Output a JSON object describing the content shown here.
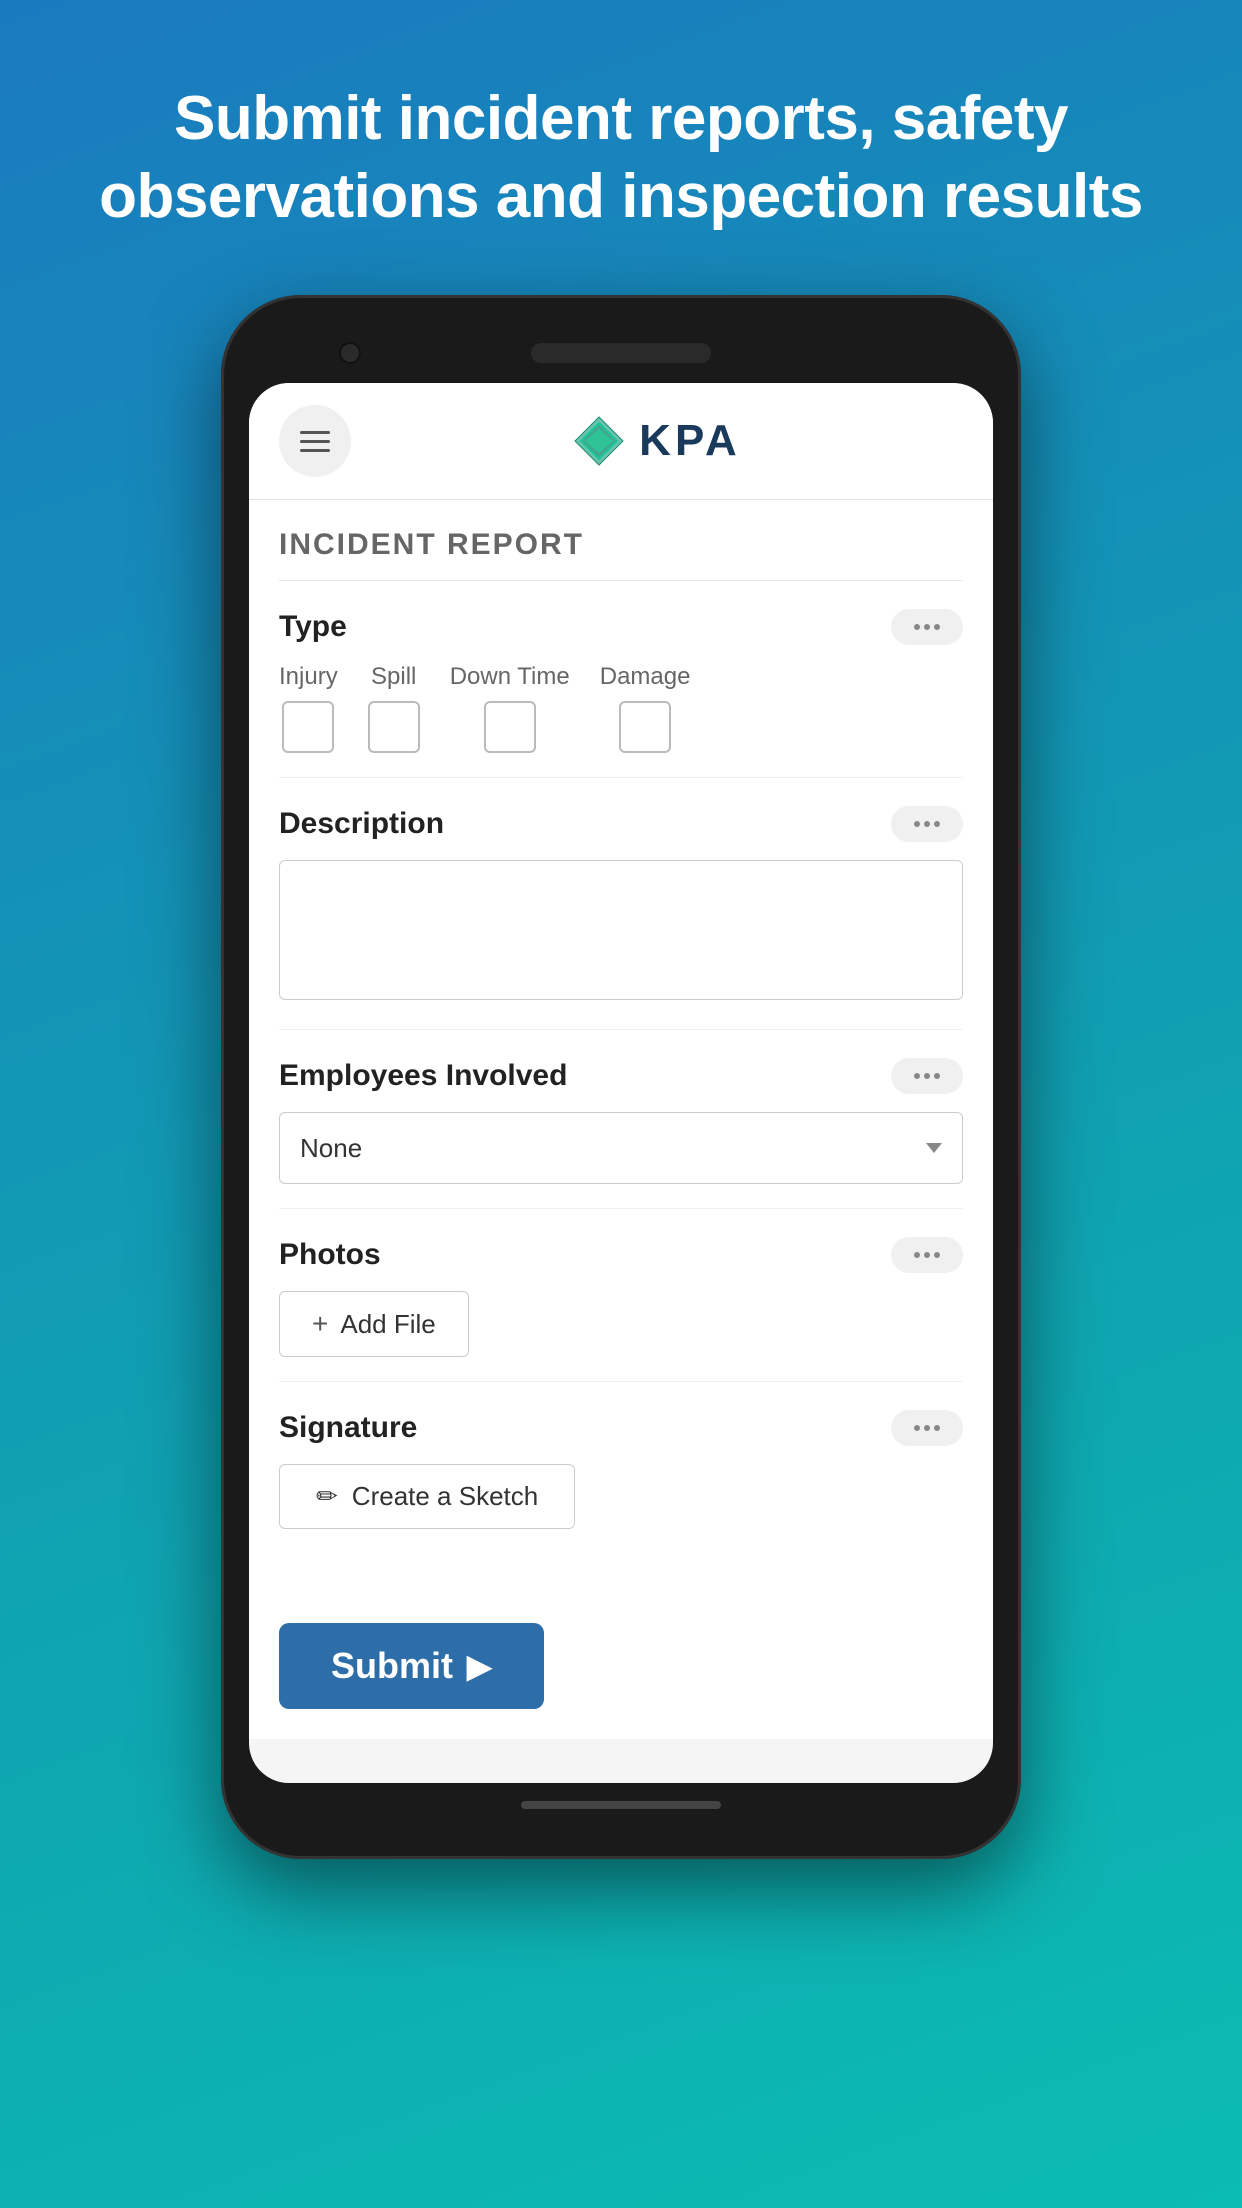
{
  "header": {
    "title": "Submit incident reports, safety observations and inspection results"
  },
  "app": {
    "menu_label": "Menu",
    "logo_text": "KPA",
    "form_title": "INCIDENT REPORT"
  },
  "type_section": {
    "label": "Type",
    "more": "...",
    "options": [
      {
        "id": "injury",
        "label": "Injury",
        "checked": false
      },
      {
        "id": "spill",
        "label": "Spill",
        "checked": false
      },
      {
        "id": "downtime",
        "label": "Down Time",
        "checked": false
      },
      {
        "id": "damage",
        "label": "Damage",
        "checked": false
      }
    ]
  },
  "description_section": {
    "label": "Description",
    "more": "...",
    "placeholder": ""
  },
  "employees_section": {
    "label": "Employees Involved",
    "more": "...",
    "options": [
      "None"
    ],
    "selected": "None"
  },
  "photos_section": {
    "label": "Photos",
    "more": "...",
    "add_file_label": "Add File",
    "plus": "+"
  },
  "signature_section": {
    "label": "Signature",
    "more": "...",
    "sketch_label": "Create a Sketch",
    "pencil": "✏"
  },
  "submit": {
    "label": "Submit",
    "arrow": "▶"
  },
  "colors": {
    "brand_blue": "#2d6da8",
    "kpa_dark": "#1a3a5c",
    "bg_gradient_start": "#1a7abf",
    "bg_gradient_end": "#0bbcb2"
  }
}
